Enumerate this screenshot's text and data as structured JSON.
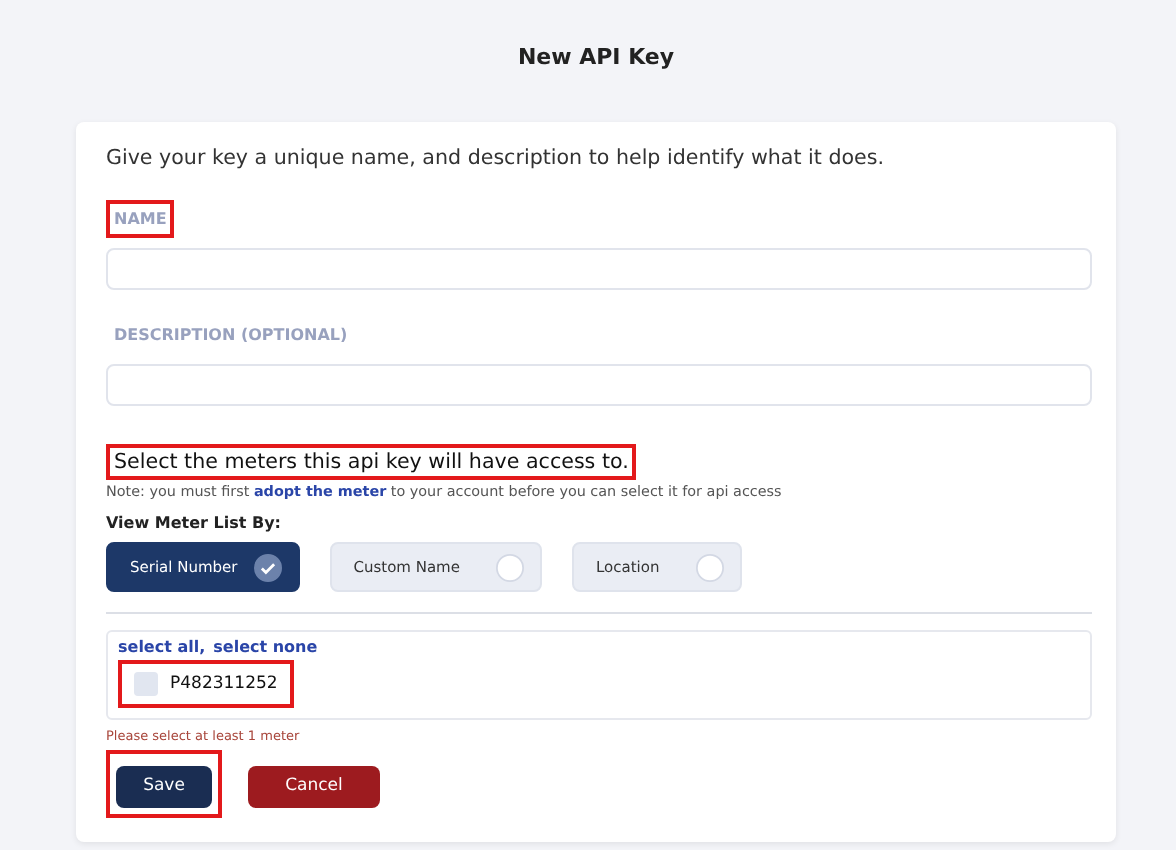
{
  "title": "New API Key",
  "intro": "Give your key a unique name, and description to help identify what it does.",
  "fields": [
    {
      "label": "NAME",
      "highlighted": true
    },
    {
      "label": "DESCRIPTION (OPTIONAL)",
      "highlighted": false
    }
  ],
  "meters_prompt": {
    "text": "Select the meters this api key will have access to.",
    "highlighted": true
  },
  "note": {
    "before": "Note: you must first ",
    "link": "adopt the meter",
    "after": " to your account before you can select it for api access"
  },
  "view_by": {
    "label": "View Meter List By:",
    "options": [
      {
        "label": "Serial Number",
        "selected": true
      },
      {
        "label": "Custom Name",
        "selected": false
      },
      {
        "label": "Location",
        "selected": false
      }
    ]
  },
  "select_links": [
    "select all,",
    "select none"
  ],
  "meters": [
    {
      "serial": "P482311252",
      "checked": false,
      "highlighted": true
    }
  ],
  "error": "Please select at least 1 meter",
  "buttons": [
    {
      "label": "Save",
      "kind": "primary",
      "highlighted": true
    },
    {
      "label": "Cancel",
      "kind": "danger",
      "highlighted": false
    }
  ]
}
